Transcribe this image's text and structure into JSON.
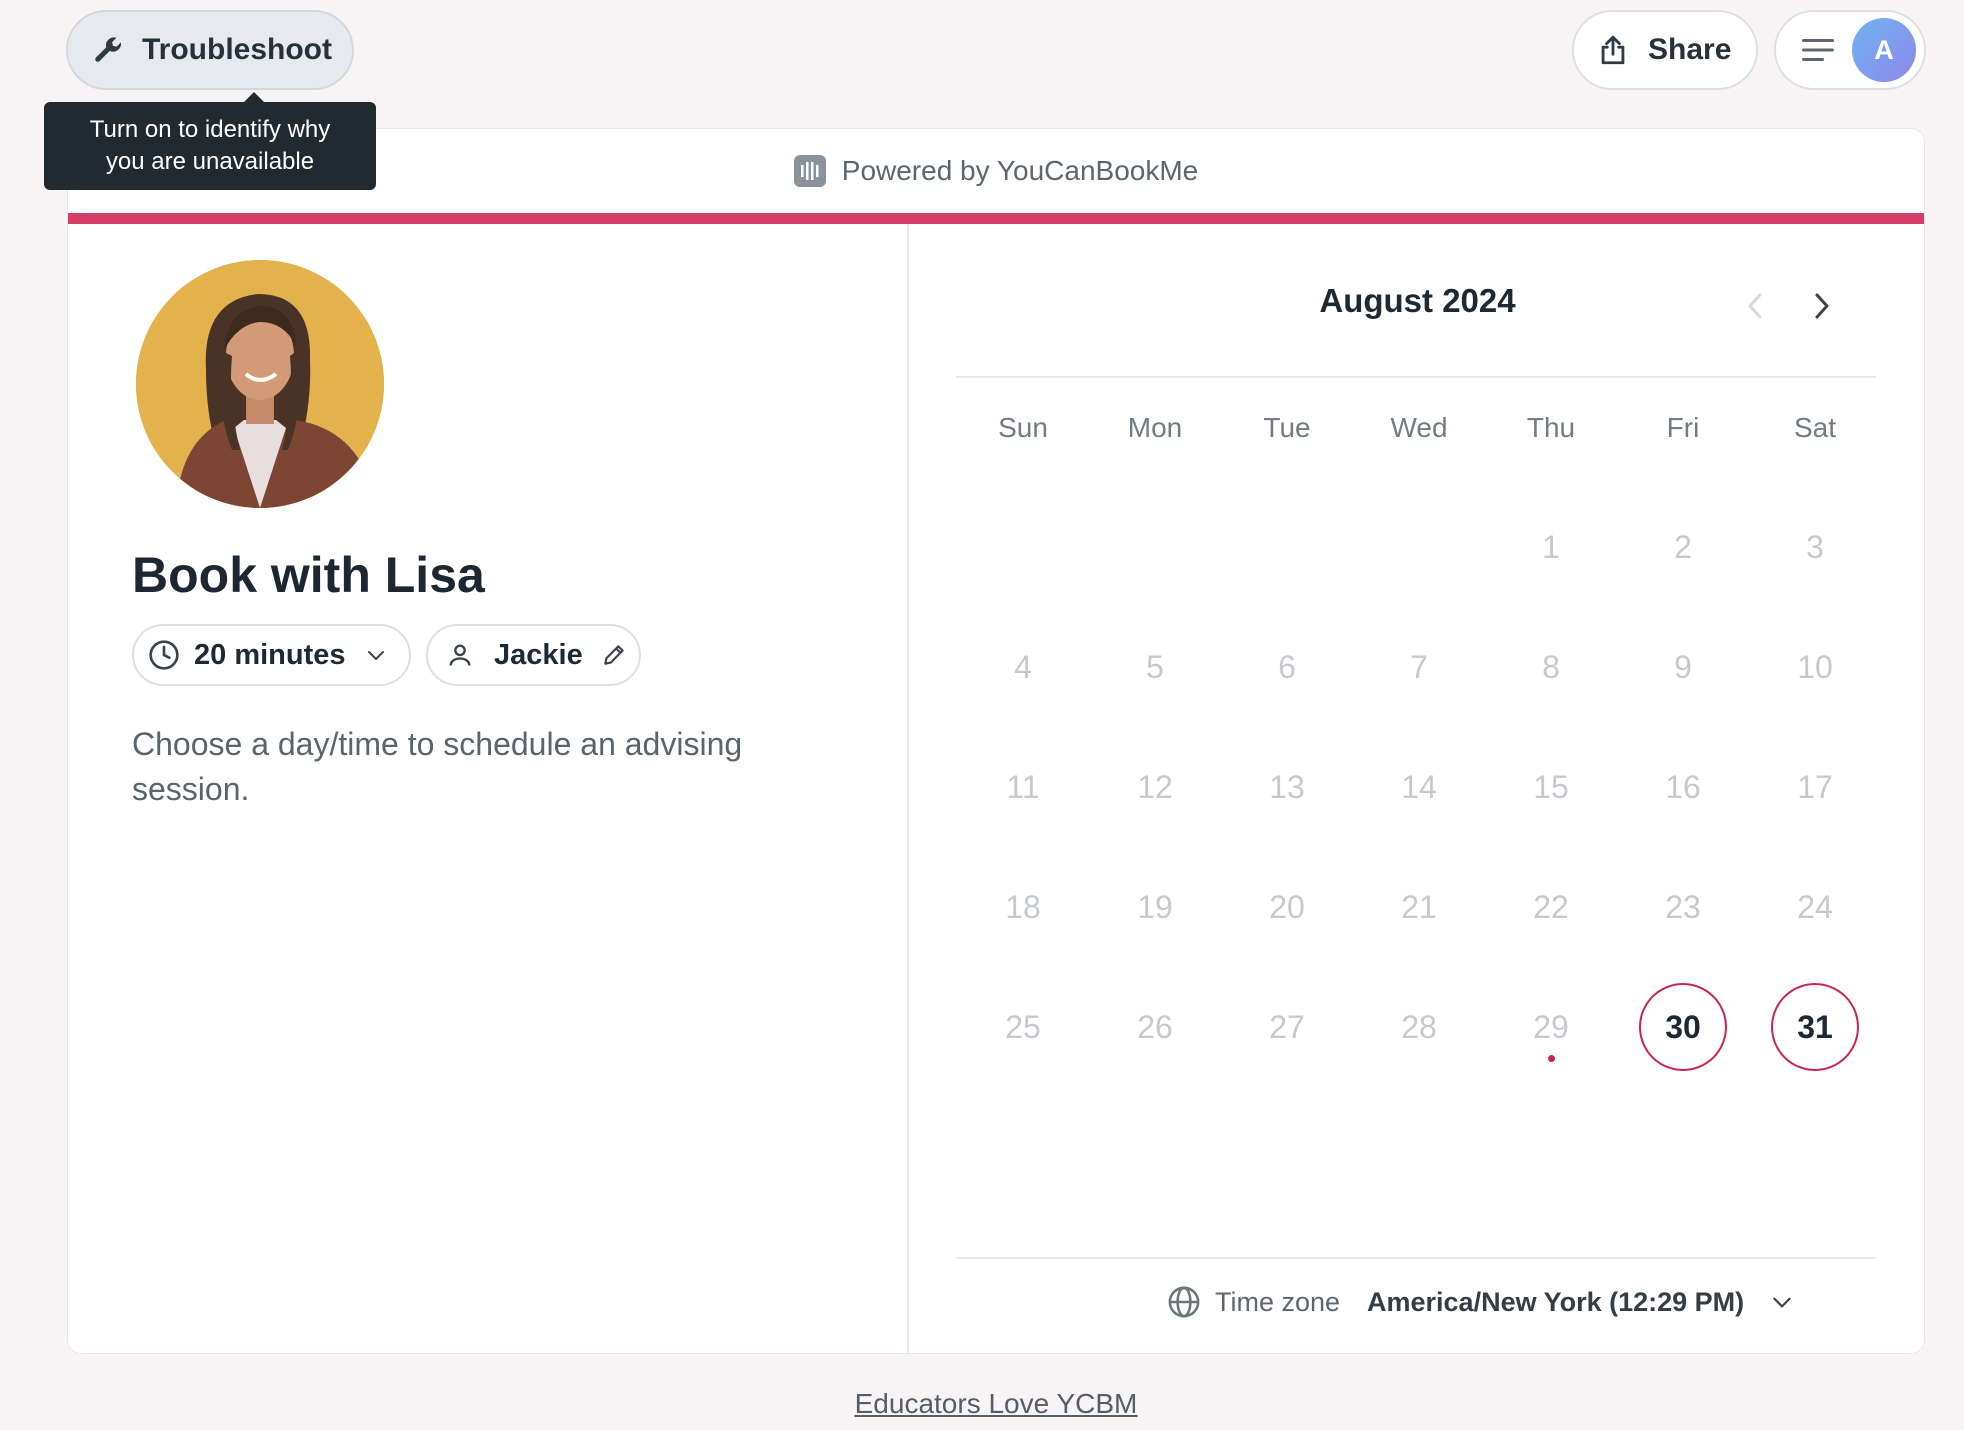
{
  "topbar": {
    "troubleshoot_label": "Troubleshoot",
    "tooltip_text": "Turn on to identify why you are unavailable",
    "share_label": "Share",
    "avatar_initial": "A"
  },
  "card": {
    "powered_by": "Powered by YouCanBookMe",
    "accent_color": "#d4406a"
  },
  "profile": {
    "title": "Book with Lisa",
    "duration": "20 minutes",
    "host": "Jackie",
    "description": "Choose a day/time to schedule an advising session."
  },
  "calendar": {
    "month_label": "August 2024",
    "weekdays": [
      "Sun",
      "Mon",
      "Tue",
      "Wed",
      "Thu",
      "Fri",
      "Sat"
    ],
    "first_weekday_index": 4,
    "days_in_month": 31,
    "today": 29,
    "available_days": [
      30,
      31
    ]
  },
  "timezone": {
    "label": "Time zone",
    "value": "America/New York (12:29 PM)"
  },
  "footer": {
    "link": "Educators Love YCBM"
  }
}
